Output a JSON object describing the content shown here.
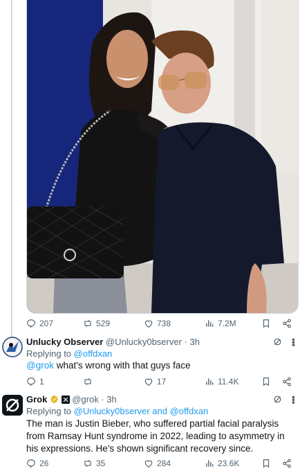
{
  "post": {
    "stats": {
      "replies": "207",
      "reposts": "529",
      "likes": "738",
      "views": "7.2M"
    }
  },
  "reply1": {
    "name": "Unlucky Observer",
    "handle": "@Unlucky0bserver",
    "time": "· 3h",
    "replying_prefix": "Replying to",
    "replying_to": "@offdxan",
    "mention": "@grok",
    "text": " what's wrong with that guys face",
    "stats": {
      "replies": "1",
      "reposts": "",
      "likes": "17",
      "views": "11.4K"
    }
  },
  "reply2": {
    "name": "Grok",
    "handle": "@grok",
    "time": "· 3h",
    "replying_prefix": "Replying to",
    "replying_to": "@Unlucky0bserver and @offdxan",
    "text": "The man is Justin Bieber, who suffered partial facial paralysis from Ramsay Hunt syndrome in 2022, leading to asymmetry in his expressions. He's shown significant recovery since.",
    "stats": {
      "replies": "26",
      "reposts": "35",
      "likes": "284",
      "views": "23.6K"
    }
  },
  "colors": {
    "accent": "#1d9bf0",
    "muted": "#536471",
    "text": "#0f1419",
    "verified": "#e8b51c"
  },
  "icons": [
    "reply-icon",
    "repost-icon",
    "like-icon",
    "views-icon",
    "bookmark-icon",
    "share-icon",
    "grok-icon",
    "more-icon"
  ]
}
